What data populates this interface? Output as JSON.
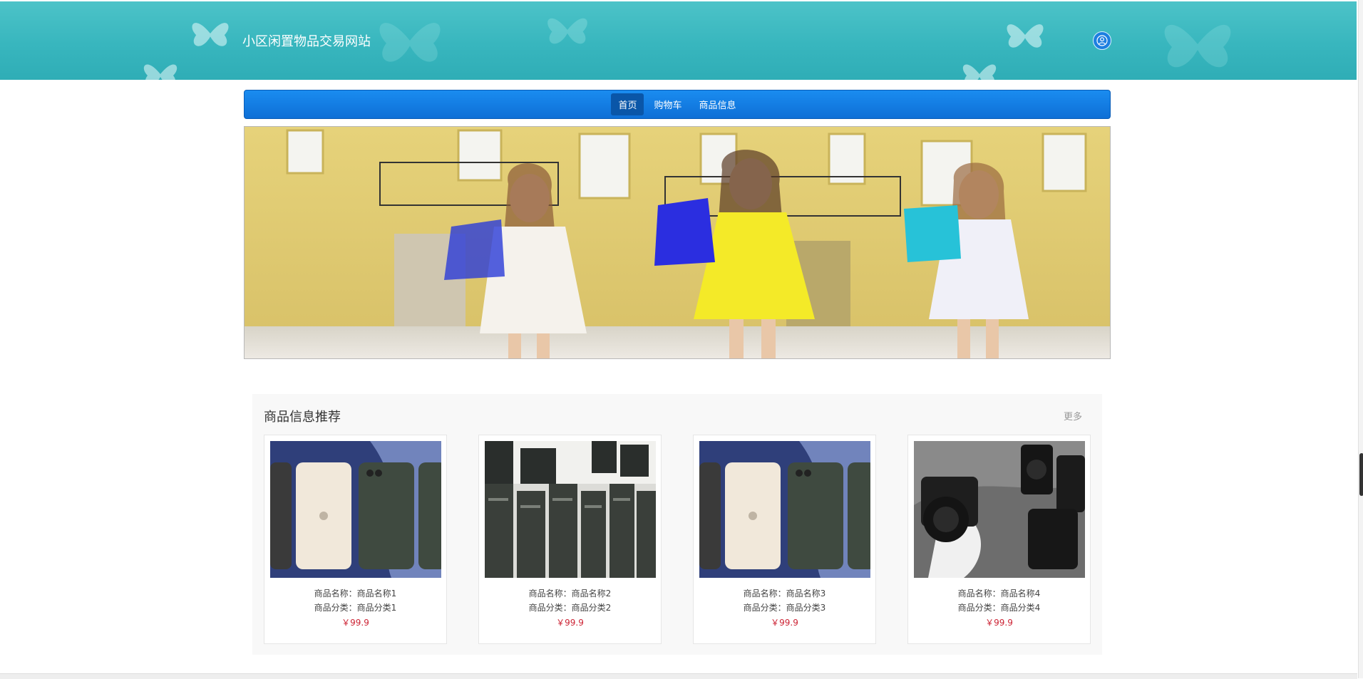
{
  "header": {
    "site_title": "小区闲置物品交易网站",
    "user_icon": "user-circle-icon"
  },
  "nav": {
    "items": [
      {
        "label": "首页",
        "active": true
      },
      {
        "label": "购物车",
        "active": false
      },
      {
        "label": "商品信息",
        "active": false
      }
    ]
  },
  "section": {
    "title": "商品信息推荐",
    "more_label": "更多",
    "products": [
      {
        "name_line": "商品名称：商品名称1",
        "category_line": "商品分类：商品分类1",
        "price": "￥99.9",
        "image": "phones-photo"
      },
      {
        "name_line": "商品名称：商品名称2",
        "category_line": "商品分类：商品分类2",
        "price": "￥99.9",
        "image": "computers-photo"
      },
      {
        "name_line": "商品名称：商品名称3",
        "category_line": "商品分类：商品分类3",
        "price": "￥99.9",
        "image": "phones-photo"
      },
      {
        "name_line": "商品名称：商品名称4",
        "category_line": "商品分类：商品分类4",
        "price": "￥99.9",
        "image": "camera-photo"
      }
    ]
  },
  "colors": {
    "header_teal": "#38b6be",
    "nav_blue": "#0e6fd6",
    "price_red": "#cc2233"
  }
}
